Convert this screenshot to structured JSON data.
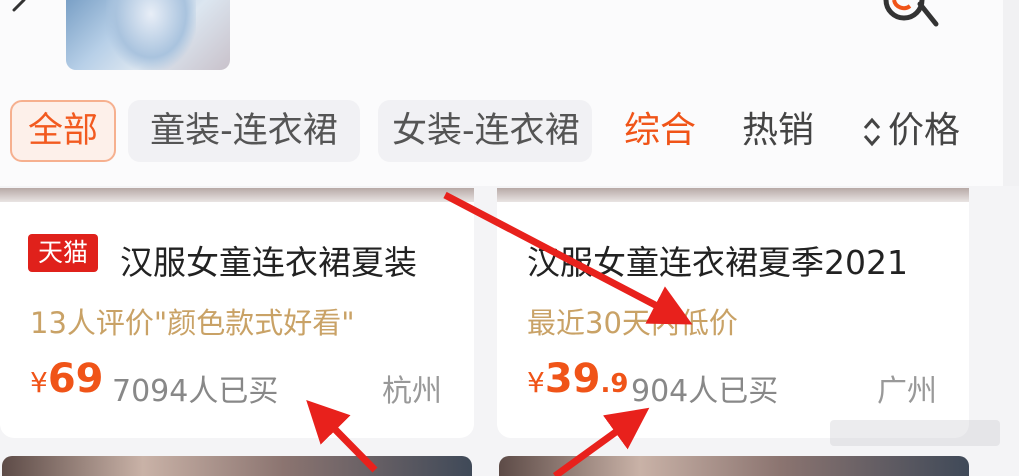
{
  "filters": {
    "all": "全部",
    "chip2": "童装-连衣裙",
    "chip3": "女装-连衣裙"
  },
  "sort": {
    "general": "综合",
    "hot": "热销",
    "price": "价格"
  },
  "products": [
    {
      "badge": "天猫",
      "title": "汉服女童连衣裙夏装",
      "tag": "13人评价\"颜色款式好看\"",
      "currency": "¥",
      "price_int": "69",
      "price_dec": "",
      "sold": "7094人已买",
      "location": "杭州"
    },
    {
      "badge": "",
      "title": "汉服女童连衣裙夏季2021",
      "tag": "最近30天内低价",
      "currency": "¥",
      "price_int": "39",
      "price_dec": ".9",
      "sold": "904人已买",
      "location": "广州"
    }
  ],
  "colors": {
    "accent": "#f05418",
    "tag_gold": "#c9a266",
    "tmall_red": "#e0211b",
    "annotation_arrow": "#e8211c"
  }
}
